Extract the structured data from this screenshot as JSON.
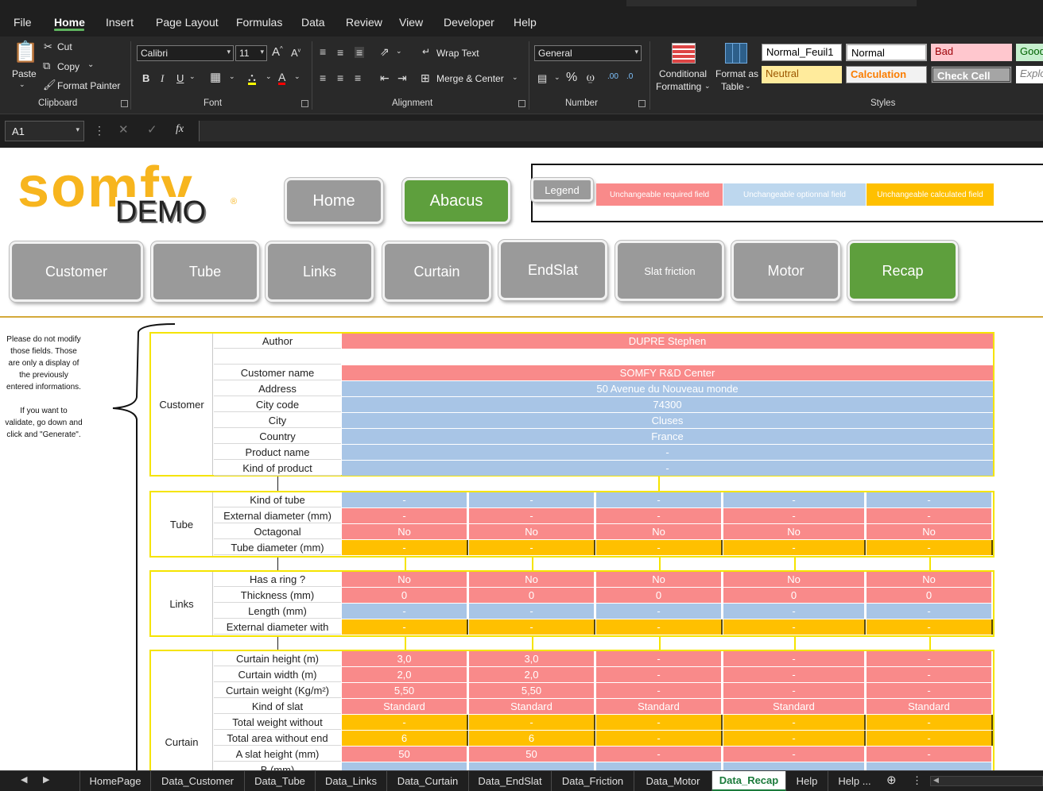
{
  "menu": {
    "tabs": [
      "File",
      "Home",
      "Insert",
      "Page Layout",
      "Formulas",
      "Data",
      "Review",
      "View",
      "Developer",
      "Help"
    ]
  },
  "ribbon": {
    "clipboard": {
      "paste": "Paste",
      "cut": "Cut",
      "copy": "Copy",
      "format_painter": "Format Painter",
      "label": "Clipboard"
    },
    "font": {
      "name": "Calibri",
      "size": "11",
      "label": "Font"
    },
    "alignment": {
      "wrap_text": "Wrap Text",
      "merge_center": "Merge & Center",
      "label": "Alignment"
    },
    "number": {
      "format": "General",
      "label": "Number"
    },
    "styles": {
      "conditional": "Conditional",
      "formatting": "Formatting",
      "format_as": "Format as",
      "table": "Table",
      "normal_feuil1": "Normal_Feuil1",
      "normal": "Normal",
      "bad": "Bad",
      "good": "Good",
      "neutral": "Neutral",
      "calculation": "Calculation",
      "check_cell": "Check Cell",
      "explanatory": "Explo",
      "label": "Styles"
    }
  },
  "formula_bar": {
    "name_box": "A1",
    "fx": "fx"
  },
  "sheet": {
    "logo_text": "somfy",
    "demo_text": "DEMO",
    "buttons": {
      "home": "Home",
      "abacus": "Abacus",
      "legend": "Legend"
    },
    "legend": {
      "required": "Unchangeable required field",
      "optional": "Unchangeable optionnal field",
      "calculated": "Unchangeable calculated field"
    },
    "nav": [
      "Customer",
      "Tube",
      "Links",
      "Curtain",
      "EndSlat",
      "Slat friction",
      "Motor",
      "Recap"
    ],
    "note": {
      "line1": "Please do not modify",
      "line2": "those fields. Those",
      "line3": "are only a display of",
      "line4": "the previously",
      "line5": "entered informations.",
      "line6": "If you want to",
      "line7": "validate, go down and",
      "line8": "click and \"Generate\"."
    },
    "customer": {
      "section": "Customer",
      "labels": [
        "Author",
        "",
        "Customer name",
        "Address",
        "City code",
        "City",
        "Country",
        "Product name",
        "Kind of product"
      ],
      "values": [
        "DUPRE Stephen",
        "",
        "SOMFY R&D Center",
        "50 Avenue du Nouveau monde",
        "74300",
        "Cluses",
        "France",
        "-",
        "-"
      ]
    },
    "tube": {
      "section": "Tube",
      "labels": [
        "Kind of tube",
        "External diameter (mm)",
        "Octagonal",
        "Tube diameter (mm)"
      ],
      "rows": [
        [
          "-",
          "-",
          "-",
          "-",
          "-"
        ],
        [
          "-",
          "-",
          "-",
          "-",
          "-"
        ],
        [
          "No",
          "No",
          "No",
          "No",
          "No"
        ],
        [
          "-",
          "-",
          "-",
          "-",
          "-"
        ]
      ]
    },
    "links": {
      "section": "Links",
      "labels": [
        "Has a ring ?",
        "Thickness (mm)",
        "Length (mm)",
        "External diameter with"
      ],
      "rows": [
        [
          "No",
          "No",
          "No",
          "No",
          "No"
        ],
        [
          "0",
          "0",
          "0",
          "0",
          "0"
        ],
        [
          "-",
          "-",
          "-",
          "-",
          "-"
        ],
        [
          "-",
          "-",
          "-",
          "-",
          "-"
        ]
      ]
    },
    "curtain": {
      "section": "Curtain",
      "labels": [
        "Curtain height (m)",
        "Curtain width (m)",
        "Curtain weight (Kg/m²)",
        "Kind of slat",
        "Total weight without",
        "Total area without end",
        "A slat height (mm)",
        "B (mm)"
      ],
      "rows": [
        [
          "3,0",
          "3,0",
          "-",
          "-",
          "-"
        ],
        [
          "2,0",
          "2,0",
          "-",
          "-",
          "-"
        ],
        [
          "5,50",
          "5,50",
          "-",
          "-",
          "-"
        ],
        [
          "Standard",
          "Standard",
          "Standard",
          "Standard",
          "Standard"
        ],
        [
          "-",
          "-",
          "-",
          "-",
          "-"
        ],
        [
          "6",
          "6",
          "-",
          "-",
          "-"
        ],
        [
          "50",
          "50",
          "-",
          "-",
          "-"
        ],
        [
          "",
          "",
          "",
          "",
          ""
        ]
      ]
    }
  },
  "sheet_tabs": [
    "HomePage",
    "Data_Customer",
    "Data_Tube",
    "Data_Links",
    "Data_Curtain",
    "Data_EndSlat",
    "Data_Friction",
    "Data_Motor",
    "Data_Recap",
    "Help",
    "Help ..."
  ],
  "colors": {
    "required": "#f98a8a",
    "optional": "#a8c5e6",
    "calculated": "#ffc000",
    "button_grey": "#9a9a9a",
    "button_green": "#5e9f3d",
    "logo": "#f7b51e"
  }
}
